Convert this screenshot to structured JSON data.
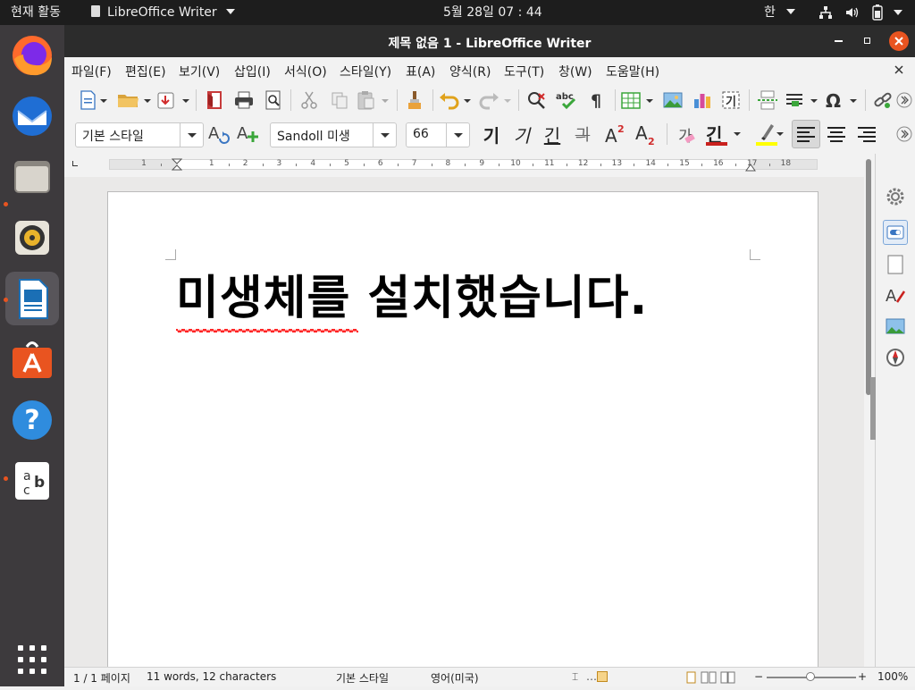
{
  "topbar": {
    "activities": "현재 활동",
    "app_menu": "LibreOffice Writer",
    "clock": "5월 28일  07 : 44",
    "input_method": "한"
  },
  "window": {
    "title": "제목 없음 1 - LibreOffice Writer"
  },
  "menu": [
    "파일(F)",
    "편집(E)",
    "보기(V)",
    "삽입(I)",
    "서식(O)",
    "스타일(Y)",
    "표(A)",
    "양식(R)",
    "도구(T)",
    "창(W)",
    "도움말(H)"
  ],
  "toolbar": {
    "paragraph_style": "기본 스타일",
    "font_name": "Sandoll 미생",
    "font_size": "66",
    "bold_label": "기",
    "italic_label": "기",
    "underline_label": "긴",
    "strike_label": "긔",
    "char_special_label": "가",
    "font_color_label": "긴",
    "superscript_sym": "2",
    "subscript_sym": "2"
  },
  "ruler": {
    "ticks": [
      "1",
      "1",
      "2",
      "3",
      "4",
      "5",
      "6",
      "7",
      "8",
      "9",
      "10",
      "11",
      "12",
      "13",
      "14",
      "15",
      "16",
      "17",
      "18"
    ]
  },
  "document": {
    "text": "미생체를 설치했습니다."
  },
  "status": {
    "page": "1 / 1 페이지",
    "words": "11 words, 12 characters",
    "style": "기본 스타일",
    "language": "영어(미국)",
    "zoom": "100%"
  },
  "colors": {
    "ubuntu_orange": "#e95420",
    "font_color_bar": "#c9211e",
    "highlight_bar": "#ffff00",
    "spell_squiggle": "#ff0000"
  }
}
